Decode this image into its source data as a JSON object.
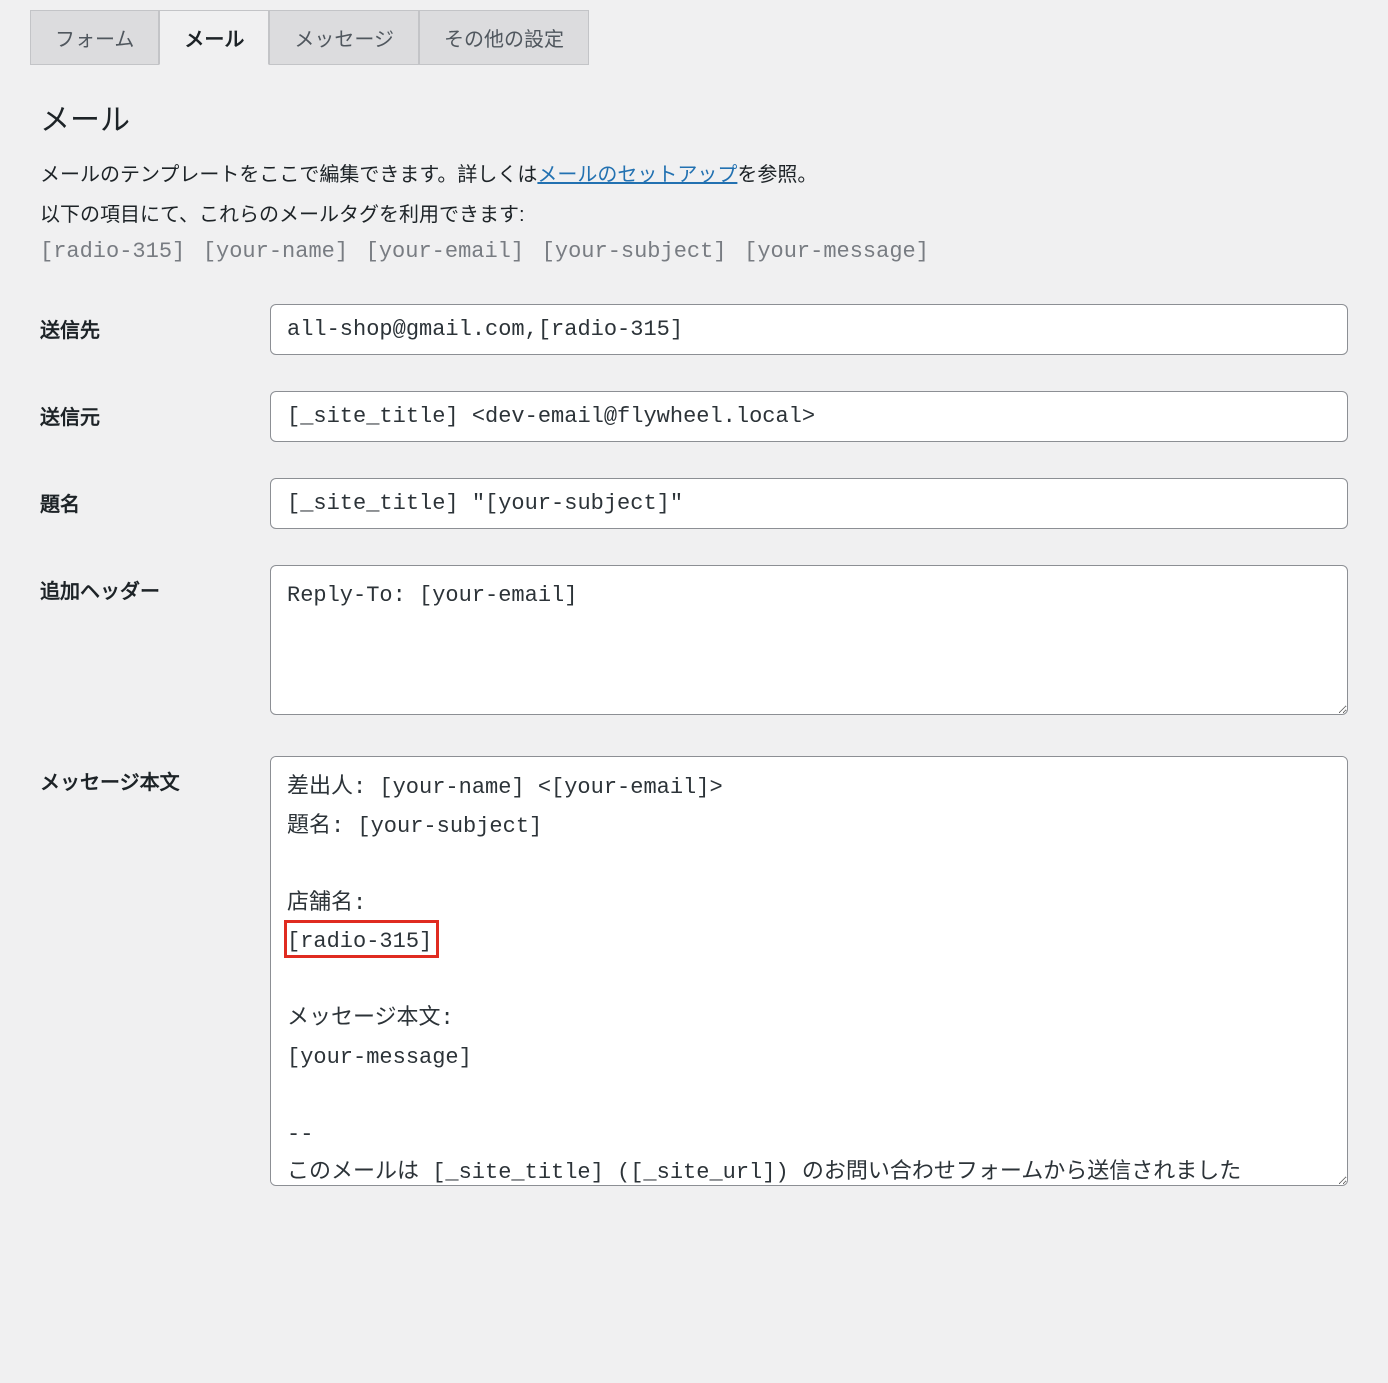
{
  "tabs": {
    "form": "フォーム",
    "mail": "メール",
    "messages": "メッセージ",
    "additional_settings": "その他の設定"
  },
  "panel": {
    "title": "メール",
    "description_prefix": "メールのテンプレートをここで編集できます。詳しくは",
    "description_link": "メールのセットアップ",
    "description_suffix": "を参照。",
    "tags_intro": "以下の項目にて、これらのメールタグを利用できます:",
    "mail_tags": "[radio-315] [your-name] [your-email] [your-subject] [your-message]"
  },
  "fields": {
    "to": {
      "label": "送信先",
      "value": "all-shop@gmail.com,[radio-315]"
    },
    "from": {
      "label": "送信元",
      "value": "[_site_title] <dev-email@flywheel.local>"
    },
    "subject": {
      "label": "題名",
      "value": "[_site_title] \"[your-subject]\""
    },
    "headers": {
      "label": "追加ヘッダー",
      "value": "Reply-To: [your-email]"
    },
    "body": {
      "label": "メッセージ本文",
      "value": "差出人: [your-name] <[your-email]>\n題名: [your-subject]\n\n店舗名:\n[radio-315]\n\nメッセージ本文:\n[your-message]\n\n-- \nこのメールは [_site_title] ([_site_url]) のお問い合わせフォームから送信されました"
    }
  }
}
